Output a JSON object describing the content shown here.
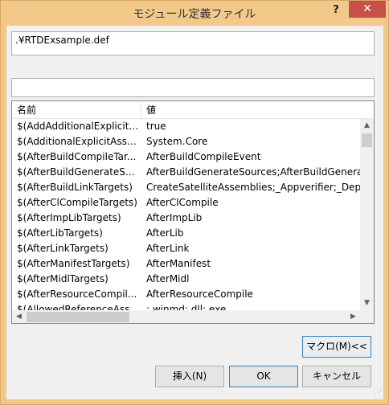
{
  "window": {
    "title": "モジュール定義ファイル",
    "help_label": "?",
    "close_label": "✕"
  },
  "path_input": {
    "value": ".¥RTDExsample.def"
  },
  "filter_input": {
    "value": ""
  },
  "list": {
    "headers": {
      "name": "名前",
      "value": "値"
    },
    "rows": [
      {
        "name": "$(AddAdditionalExplicitA...",
        "value": "true"
      },
      {
        "name": "$(AdditionalExplicitAsse...",
        "value": "System.Core"
      },
      {
        "name": "$(AfterBuildCompileTar...",
        "value": "AfterBuildCompileEvent"
      },
      {
        "name": "$(AfterBuildGenerateSo...",
        "value": "AfterBuildGenerateSources;AfterBuildGenerat"
      },
      {
        "name": "$(AfterBuildLinkTargets)",
        "value": "CreateSatelliteAssemblies;_Appverifier;_Depl"
      },
      {
        "name": "$(AfterClCompileTargets)",
        "value": "AfterClCompile"
      },
      {
        "name": "$(AfterImpLibTargets)",
        "value": "AfterImpLib"
      },
      {
        "name": "$(AfterLibTargets)",
        "value": "AfterLib"
      },
      {
        "name": "$(AfterLinkTargets)",
        "value": "AfterLink"
      },
      {
        "name": "$(AfterManifestTargets)",
        "value": "AfterManifest"
      },
      {
        "name": "$(AfterMidlTargets)",
        "value": "AfterMidl"
      },
      {
        "name": "$(AfterResourceCompil...",
        "value": "AfterResourceCompile"
      },
      {
        "name": "$(AllowedReferenceAss...",
        "value": ";.winmd;.dll;.exe"
      }
    ]
  },
  "buttons": {
    "macro": "マクロ(M)<<",
    "insert": "挿入(N)",
    "ok": "OK",
    "cancel": "キャンセル"
  },
  "icons": {
    "scroll_up": "scroll-up-arrow",
    "scroll_down": "scroll-down-arrow",
    "scroll_left": "scroll-left-arrow",
    "scroll_right": "scroll-right-arrow"
  },
  "colors": {
    "titlebar": "#f2c98a",
    "close_button": "#c7504a",
    "default_button_border": "#3c7fb1"
  }
}
